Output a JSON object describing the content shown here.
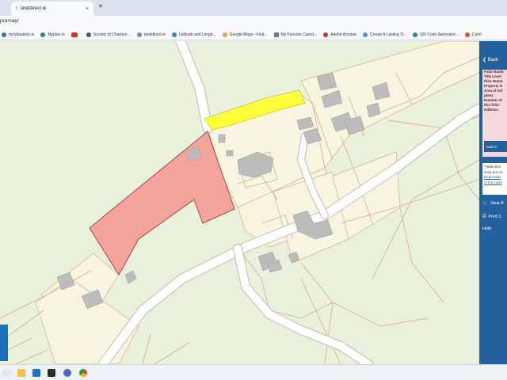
{
  "browser": {
    "tab_title": "landdirect.ie",
    "tab_close": "×",
    "new_tab": "+",
    "url_fragment": "pramap/"
  },
  "bookmarks": [
    {
      "label": "myValuation.ie",
      "color": "#3a6fb5"
    },
    {
      "label": "Myplan.ie",
      "color": "#2c8f5b"
    },
    {
      "label": "",
      "color": "#e02b2b"
    },
    {
      "label": "Society of Chartere...",
      "color": "#555555"
    },
    {
      "label": "landdirect.ie",
      "color": "#888888"
    },
    {
      "label": "Latitude and Longit...",
      "color": "#3a7bd5"
    },
    {
      "label": "Google Maps - Find...",
      "color": "#e9a42c"
    },
    {
      "label": "My Favorite Carrot...",
      "color": "#777777"
    },
    {
      "label": "Adobe Acrobat",
      "color": "#d32f2f"
    },
    {
      "label": "Create A Lasting Tr...",
      "color": "#4a90d9"
    },
    {
      "label": "QR Code Generator...",
      "color": "#2b7bd6"
    },
    {
      "label": "Confi",
      "color": "#e44d2e"
    }
  ],
  "panel": {
    "back_label": "Back",
    "fields": [
      "Folio Numb",
      "Title Level",
      "Plan Numb",
      "Property N",
      "Area of sel",
      "plans",
      "Number of",
      "this folio:",
      "Address"
    ],
    "add_button": "Add to",
    "note_lines": [
      "*Tailte Éire",
      "Area are no",
      "Registratio",
      "of the Land"
    ],
    "note_bold": "are no",
    "view_label": "View B",
    "print_label": "Print C",
    "help_label": "Help"
  },
  "colors": {
    "map_bg": "#e9f1dc",
    "road_fill": "#ffffff",
    "road_edge": "#c8b8b0",
    "plot_fill": "#f7f5e0",
    "boundary": "#d9a88a",
    "building": "#bcbcbc",
    "selected_folio": "#f4a49a",
    "adjacent_plot": "#ffff3a",
    "panel_bg": "#23629f"
  },
  "taskbar_icons": [
    "search-icon",
    "file-explorer-icon",
    "outlook-icon",
    "terminal-icon",
    "teams-icon",
    "chrome-icon"
  ]
}
